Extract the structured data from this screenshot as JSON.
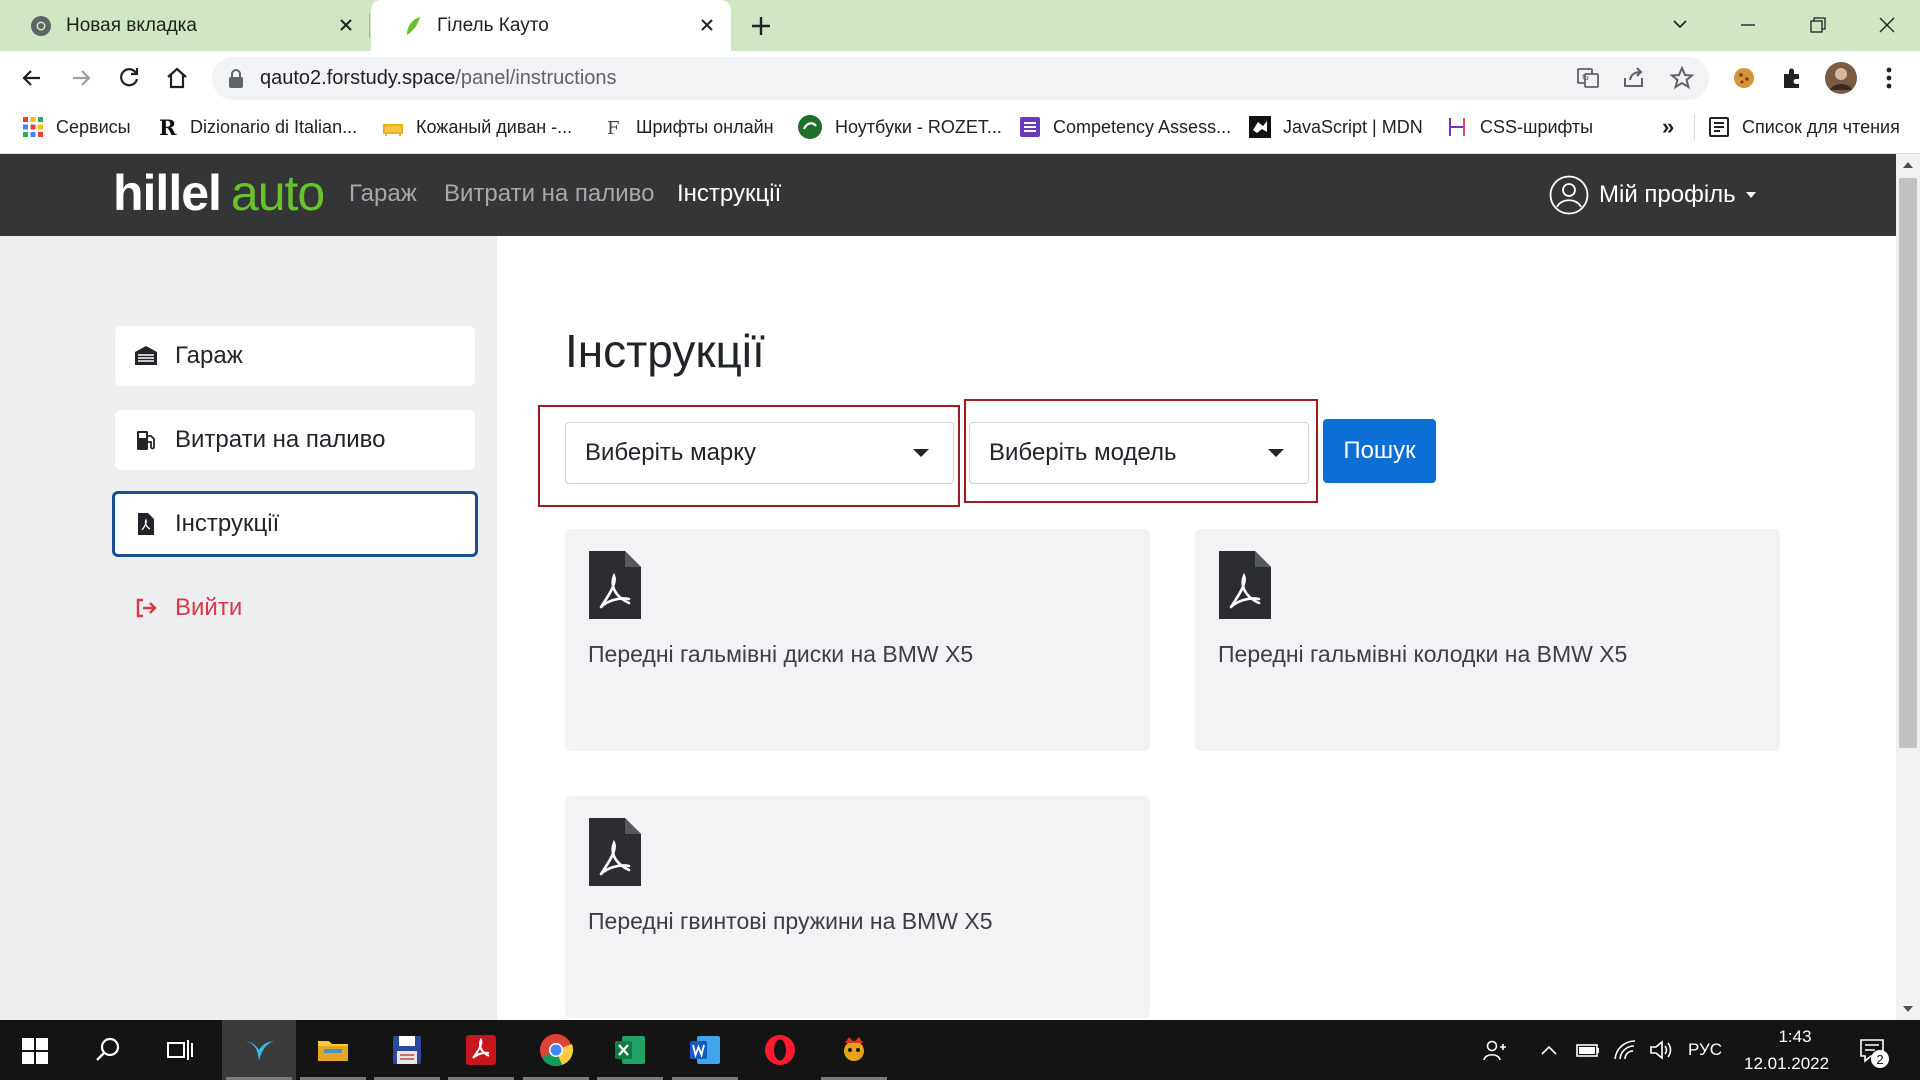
{
  "browser": {
    "tabs": [
      {
        "title": "Новая вкладка"
      },
      {
        "title": "Гілель Кауто"
      }
    ],
    "url_host": "qauto2.forstudy.space",
    "url_path": "/panel/instructions",
    "bookmarks": [
      {
        "label": "Сервисы",
        "icon": "apps-grid-icon"
      },
      {
        "label": "Dizionario di Italian...",
        "icon": "r-logo-icon"
      },
      {
        "label": "Кожаный диван -...",
        "icon": "sofa-icon"
      },
      {
        "label": "Шрифты онлайн",
        "icon": "f-font-icon"
      },
      {
        "label": "Ноутбуки - ROZET...",
        "icon": "rozetka-icon"
      },
      {
        "label": "Competency Assess...",
        "icon": "form-icon"
      },
      {
        "label": "JavaScript | MDN",
        "icon": "mdn-icon"
      },
      {
        "label": "CSS-шрифты",
        "icon": "htmlbook-icon"
      }
    ],
    "more_bookmarks": "»",
    "reading_list": "Список для чтения"
  },
  "app": {
    "logo_main": "hillel",
    "logo_accent": "auto",
    "nav": [
      {
        "label": "Гараж"
      },
      {
        "label": "Витрати на паливо"
      },
      {
        "label": "Інструкції"
      }
    ],
    "profile_label": "Мій профіль",
    "sidebar": [
      {
        "label": "Гараж",
        "icon": "garage-icon"
      },
      {
        "label": "Витрати на паливо",
        "icon": "fuel-pump-icon"
      },
      {
        "label": "Інструкції",
        "icon": "pdf-file-icon"
      },
      {
        "label": "Вийти",
        "icon": "sign-out-icon"
      }
    ],
    "page_title": "Інструкції",
    "brand_select": "Виберіть марку",
    "model_select": "Виберіть модель",
    "search_button": "Пошук",
    "instructions": [
      {
        "title": "Передні гальмівні диски на BMW X5"
      },
      {
        "title": "Передні гальмівні колодки на BMW X5"
      },
      {
        "title": "Передні гвинтові пружини на BMW X5"
      }
    ],
    "colors": {
      "accent_green": "#6ac22a",
      "header_bg": "#333537",
      "primary_button": "#0b6fd6",
      "logout_red": "#dc3545",
      "highlight_box": "#9e1c1c"
    }
  },
  "taskbar": {
    "language": "РУС",
    "time": "1:43",
    "date": "12.01.2022",
    "notifications_count": "2"
  }
}
